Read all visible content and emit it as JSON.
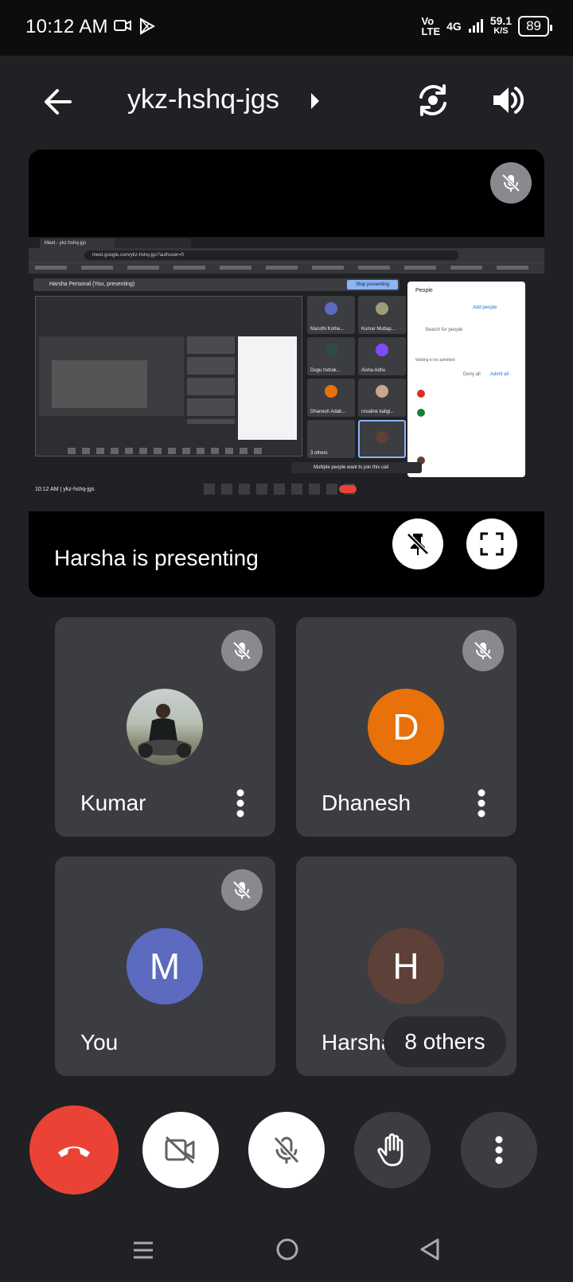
{
  "status": {
    "time": "10:12 AM",
    "network_vo": "Vo",
    "network_lte": "LTE",
    "network_4g": "4G",
    "speed": "59.1",
    "speed_unit": "K/S",
    "battery": "89"
  },
  "header": {
    "meeting_code": "ykz-hshq-jgs"
  },
  "presentation": {
    "label": "Harsha is presenting",
    "shared_screen": {
      "tab1": "Meet - ykz-hshq-jgs",
      "url": "meet.google.com/ykz-hshq-jgs?authuser=0",
      "banner": "Harsha Personal (You, presenting)",
      "stop_btn": "Stop presenting",
      "people_title": "People",
      "add_people": "Add people",
      "search": "Search for people",
      "waiting": "Waiting to be admitted",
      "deny": "Deny all",
      "admit_all": "Admit all",
      "time": "10:12 AM  |  ykz-hshq-jgs",
      "toast": "Multiple people want to join this call",
      "names": [
        "Maruthi Kothe...",
        "Kumar Muttap...",
        "Dugu Indrak...",
        "Aisha Adhu",
        "Dhanesh Adab...",
        "rosaline kaligi...",
        "3 others"
      ]
    }
  },
  "participants": [
    {
      "name": "Kumar",
      "initial": "",
      "color": "#888888"
    },
    {
      "name": "Dhanesh",
      "initial": "D",
      "color": "#e8710a"
    },
    {
      "name": "You",
      "initial": "M",
      "color": "#5c6bc0"
    },
    {
      "name": "Harsha",
      "initial": "H",
      "color": "#5d4037"
    }
  ],
  "others_label": "8 others",
  "colors": {
    "end_call": "#ea4335",
    "tile_bg": "#3c3d41",
    "app_bg": "#202124"
  }
}
